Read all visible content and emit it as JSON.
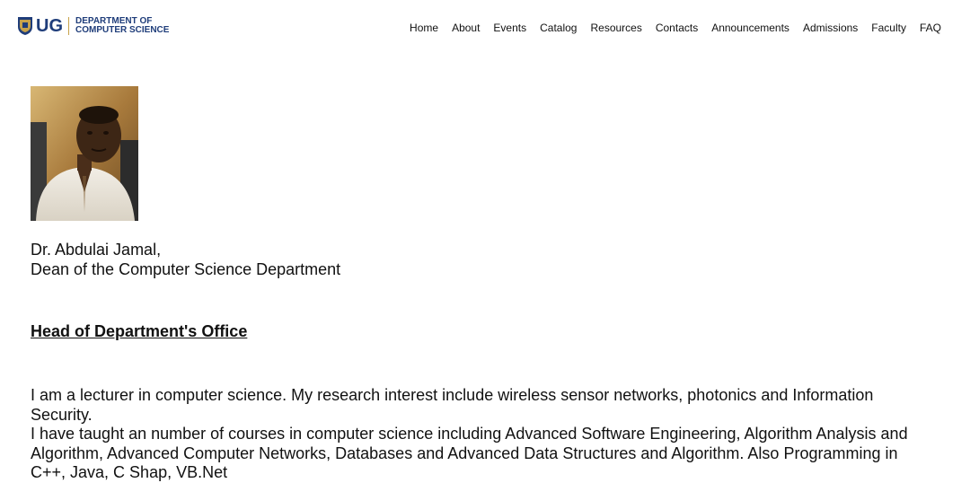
{
  "header": {
    "logo": {
      "abbr": "UG",
      "line1": "DEPARTMENT OF",
      "line2": "COMPUTER SCIENCE"
    },
    "nav": [
      {
        "label": "Home",
        "name": "nav-home"
      },
      {
        "label": "About",
        "name": "nav-about"
      },
      {
        "label": "Events",
        "name": "nav-events"
      },
      {
        "label": "Catalog",
        "name": "nav-catalog"
      },
      {
        "label": "Resources",
        "name": "nav-resources"
      },
      {
        "label": "Contacts",
        "name": "nav-contacts"
      },
      {
        "label": "Announcements",
        "name": "nav-announcements"
      },
      {
        "label": "Admissions",
        "name": "nav-admissions"
      },
      {
        "label": "Faculty",
        "name": "nav-faculty"
      },
      {
        "label": "FAQ",
        "name": "nav-faq"
      }
    ]
  },
  "profile": {
    "name": "Dr. Abdulai Jamal,",
    "title": "Dean of the Computer Science Department"
  },
  "section": {
    "heading": "Head of Department's Office"
  },
  "bio": {
    "paragraph1": "I am a lecturer in computer science. My research interest include wireless sensor networks, photonics and Information Security.",
    "paragraph2": "I have taught an number of courses in computer science including Advanced Software Engineering, Algorithm Analysis and Algorithm, Advanced Computer Networks, Databases and Advanced Data Structures and Algorithm. Also Programming in C++, Java, C Shap, VB.Net"
  },
  "colors": {
    "brand": "#1f3d7a",
    "accent": "#c7a24a"
  }
}
